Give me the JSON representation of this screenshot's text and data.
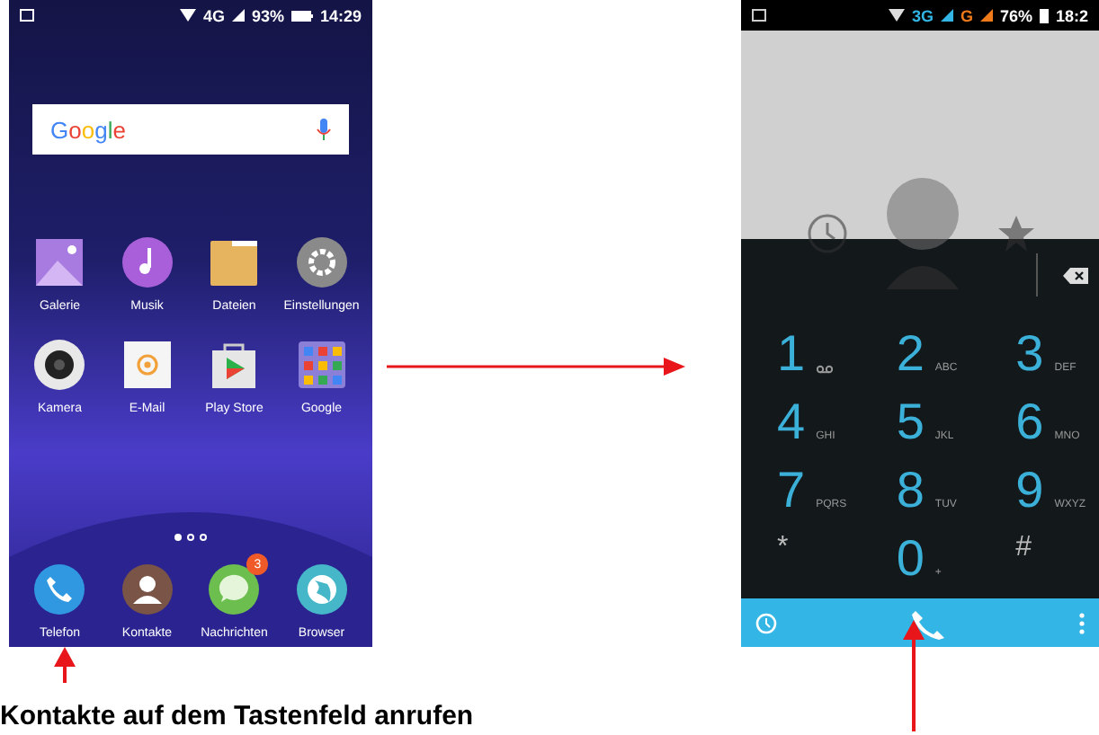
{
  "left_phone": {
    "status_bar": {
      "network": "4G",
      "battery": "93%",
      "time": "14:29"
    },
    "search_bar": {
      "logo": "Google"
    },
    "apps": [
      {
        "label": "Galerie"
      },
      {
        "label": "Musik"
      },
      {
        "label": "Dateien"
      },
      {
        "label": "Einstellungen"
      },
      {
        "label": "Kamera"
      },
      {
        "label": "E-Mail"
      },
      {
        "label": "Play Store"
      },
      {
        "label": "Google"
      }
    ],
    "page_dots": [
      {
        "selected": true
      },
      {
        "selected": false
      },
      {
        "selected": false
      }
    ],
    "dock": [
      {
        "label": "Telefon"
      },
      {
        "label": "Kontakte"
      },
      {
        "label": "Nachrichten",
        "badge": "3"
      },
      {
        "label": "Browser"
      }
    ]
  },
  "right_phone": {
    "status_bar": {
      "network_1": "3G",
      "network_2": "G",
      "battery": "76%",
      "time": "18:2"
    },
    "keys": [
      {
        "digit": "1",
        "kind": "voicemail"
      },
      {
        "digit": "2",
        "letters": "ABC",
        "kind": "letters"
      },
      {
        "digit": "3",
        "letters": "DEF",
        "kind": "letters"
      },
      {
        "digit": "4",
        "letters": "GHI",
        "kind": "letters"
      },
      {
        "digit": "5",
        "letters": "JKL",
        "kind": "letters"
      },
      {
        "digit": "6",
        "letters": "MNO",
        "kind": "letters"
      },
      {
        "digit": "7",
        "letters": "PQRS",
        "kind": "letters"
      },
      {
        "digit": "8",
        "letters": "TUV",
        "kind": "letters"
      },
      {
        "digit": "9",
        "letters": "WXYZ",
        "kind": "letters"
      },
      {
        "digit": "*",
        "kind": "symbol"
      },
      {
        "digit": "0",
        "letters": "+",
        "kind": "letters"
      },
      {
        "digit": "#",
        "kind": "symbol"
      }
    ]
  },
  "caption": "Kontakte auf dem Tastenfeld anrufen"
}
